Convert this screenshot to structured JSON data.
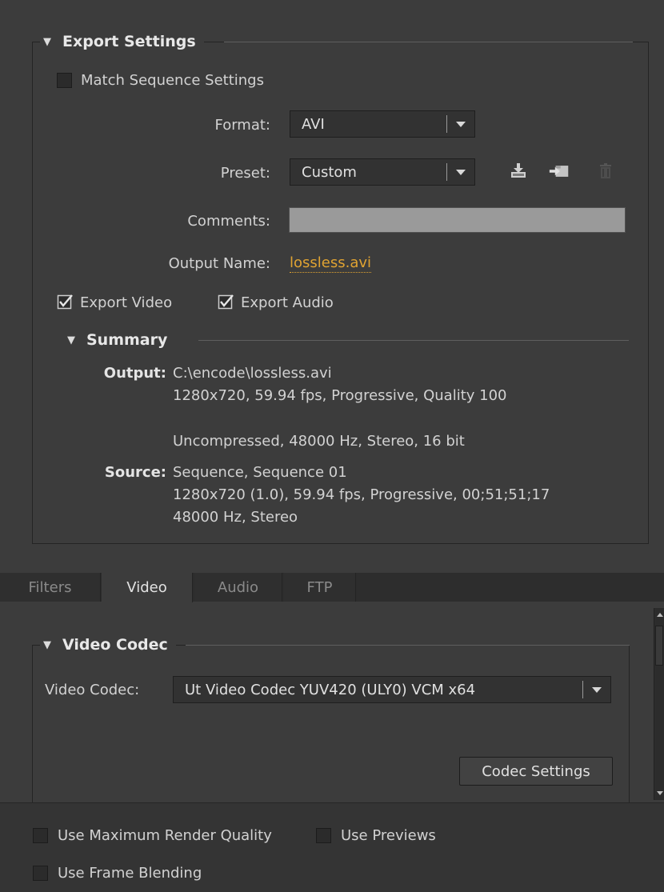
{
  "export_settings": {
    "title": "Export Settings",
    "match_sequence": {
      "label": "Match Sequence Settings",
      "checked": false
    },
    "format": {
      "label": "Format:",
      "value": "AVI"
    },
    "preset": {
      "label": "Preset:",
      "value": "Custom"
    },
    "preset_icons": [
      "save-preset-icon",
      "import-preset-icon",
      "delete-preset-icon"
    ],
    "comments": {
      "label": "Comments:",
      "value": ""
    },
    "output_name": {
      "label": "Output Name:",
      "value": "lossless.avi"
    },
    "export_video": {
      "label": "Export Video",
      "checked": true
    },
    "export_audio": {
      "label": "Export Audio",
      "checked": true
    }
  },
  "summary": {
    "title": "Summary",
    "output_key": "Output:",
    "output_lines": [
      "C:\\encode\\lossless.avi",
      "1280x720, 59.94 fps, Progressive, Quality 100",
      "Uncompressed, 48000 Hz, Stereo, 16 bit"
    ],
    "source_key": "Source:",
    "source_lines": [
      "Sequence, Sequence 01",
      "1280x720 (1.0), 59.94 fps, Progressive, 00;51;51;17",
      "48000 Hz, Stereo"
    ]
  },
  "tabs": [
    {
      "label": "Filters",
      "active": false
    },
    {
      "label": "Video",
      "active": true
    },
    {
      "label": "Audio",
      "active": false
    },
    {
      "label": "FTP",
      "active": false
    }
  ],
  "video_codec": {
    "title": "Video Codec",
    "label": "Video Codec:",
    "value": "Ut Video Codec YUV420 (ULY0) VCM x64",
    "settings_button": "Codec Settings"
  },
  "render_options": {
    "max_quality": {
      "label": "Use Maximum Render Quality",
      "checked": false
    },
    "use_previews": {
      "label": "Use Previews",
      "checked": false
    },
    "frame_blending": {
      "label": "Use Frame Blending",
      "checked": false
    }
  },
  "colors": {
    "panel_bg": "#3c3c3c",
    "link": "#e0a332",
    "comments_field": "#9a9a9a"
  }
}
